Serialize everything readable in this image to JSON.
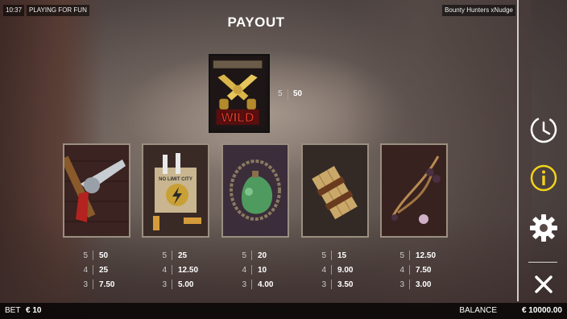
{
  "topbar": {
    "time": "10:37",
    "mode": "PLAYING FOR FUN",
    "game_title": "Bounty Hunters xNudge"
  },
  "title": "PAYOUT",
  "wild": {
    "label": "WILD",
    "pays": [
      {
        "count": "5",
        "amount": "50"
      }
    ]
  },
  "symbols": [
    {
      "name": "revolver",
      "pays": [
        {
          "count": "5",
          "amount": "50"
        },
        {
          "count": "4",
          "amount": "25"
        },
        {
          "count": "3",
          "amount": "7.50"
        }
      ]
    },
    {
      "name": "badge-bag",
      "label": "NO LIMIT CITY",
      "pays": [
        {
          "count": "5",
          "amount": "25"
        },
        {
          "count": "4",
          "amount": "12.50"
        },
        {
          "count": "3",
          "amount": "5.00"
        }
      ]
    },
    {
      "name": "canteen",
      "pays": [
        {
          "count": "5",
          "amount": "20"
        },
        {
          "count": "4",
          "amount": "10"
        },
        {
          "count": "3",
          "amount": "4.00"
        }
      ]
    },
    {
      "name": "dynamite",
      "pays": [
        {
          "count": "5",
          "amount": "15"
        },
        {
          "count": "4",
          "amount": "9.00"
        },
        {
          "count": "3",
          "amount": "3.50"
        }
      ]
    },
    {
      "name": "bolas",
      "pays": [
        {
          "count": "5",
          "amount": "12.50"
        },
        {
          "count": "4",
          "amount": "7.50"
        },
        {
          "count": "3",
          "amount": "3.00"
        }
      ]
    }
  ],
  "side_icons": [
    "history-icon",
    "info-icon",
    "settings-icon",
    "close-icon"
  ],
  "colors": {
    "info_accent": "#f2d31b",
    "card_border": "#9a8f80"
  },
  "bottom": {
    "bet_label": "BET",
    "bet_value": "€ 10",
    "balance_label": "BALANCE",
    "balance_value": "€ 10000.00"
  }
}
